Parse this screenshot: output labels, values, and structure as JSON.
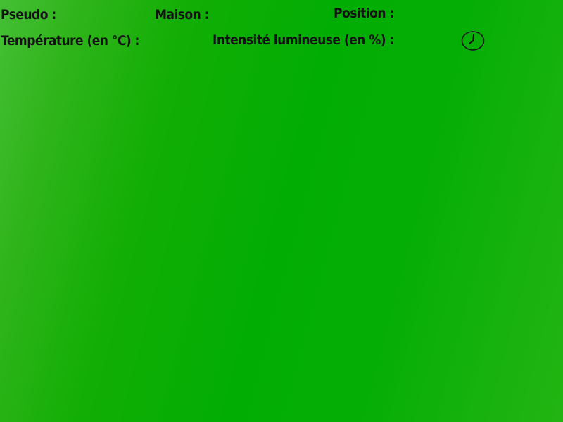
{
  "labels": {
    "pseudo": "Pseudo :",
    "maison": "Maison :",
    "position": "Position :",
    "temperature": "Température (en °C) :",
    "intensite": "Intensité lumineuse (en %) :"
  },
  "icons": {
    "clock": "clock-icon"
  },
  "colors": {
    "background": "#02ad03",
    "text": "#111111"
  }
}
